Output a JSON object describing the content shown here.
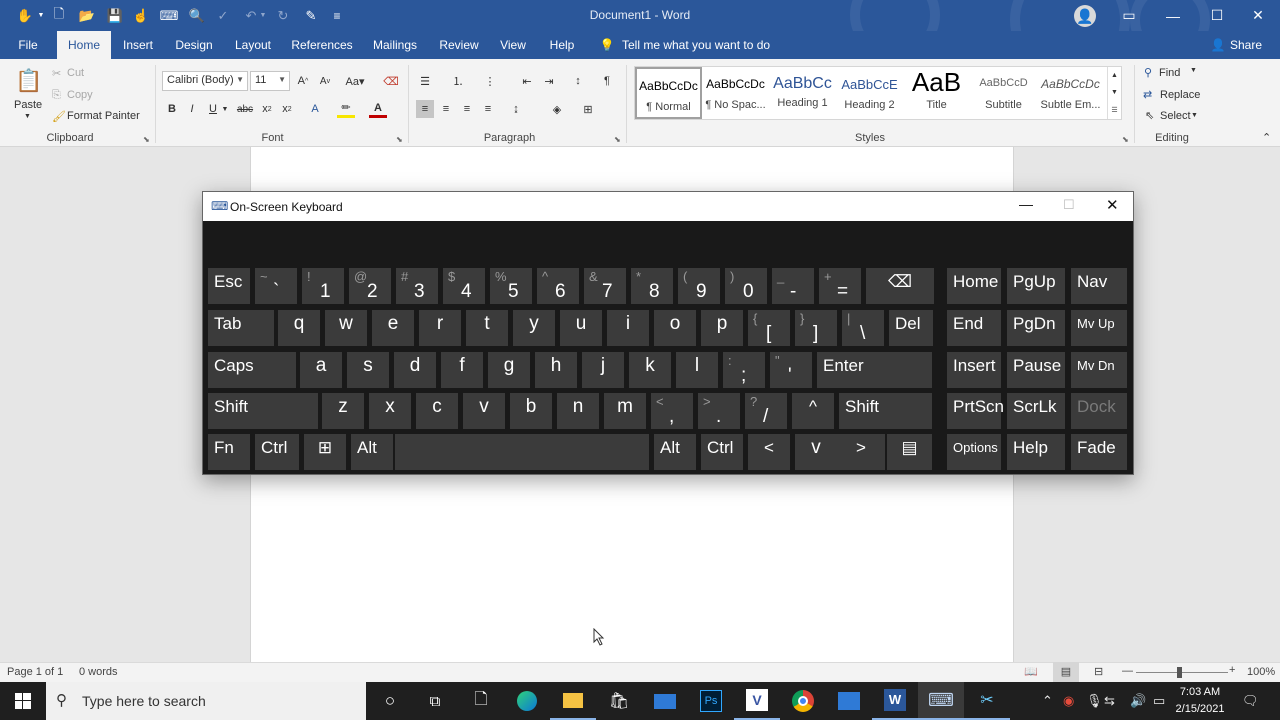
{
  "app": {
    "title": "Document1  -  Word"
  },
  "qat": [
    "autosave-icon",
    "new-document-icon",
    "open-icon",
    "save-icon",
    "touch-mode-icon",
    "undo-icon",
    "redo-icon",
    "repeat-icon",
    "print-preview-icon",
    "customize-icon"
  ],
  "tabs": [
    "File",
    "Home",
    "Insert",
    "Design",
    "Layout",
    "References",
    "Mailings",
    "Review",
    "View",
    "Help"
  ],
  "tell_me": "Tell me what you want to do",
  "share": "Share",
  "ribbon": {
    "clipboard": {
      "label": "Clipboard",
      "paste": "Paste",
      "cut": "Cut",
      "copy": "Copy",
      "format_painter": "Format Painter"
    },
    "font": {
      "label": "Font",
      "name": "Calibri (Body)",
      "size": "11"
    },
    "paragraph": {
      "label": "Paragraph"
    },
    "styles": {
      "label": "Styles",
      "items": [
        {
          "preview": "AaBbCcDc",
          "name": "¶ Normal"
        },
        {
          "preview": "AaBbCcDc",
          "name": "¶ No Spac..."
        },
        {
          "preview": "AaBbCc",
          "name": "Heading 1"
        },
        {
          "preview": "AaBbCcE",
          "name": "Heading 2"
        },
        {
          "preview": "AaB",
          "name": "Title"
        },
        {
          "preview": "AaBbCcD",
          "name": "Subtitle"
        },
        {
          "preview": "AaBbCcDc",
          "name": "Subtle Em..."
        }
      ]
    },
    "editing": {
      "label": "Editing",
      "find": "Find",
      "replace": "Replace",
      "select": "Select"
    }
  },
  "osk": {
    "title": "On-Screen Keyboard",
    "rows": [
      [
        {
          "m": "Esc"
        },
        {
          "s": "~",
          "b": "`"
        },
        {
          "s": "!",
          "b": "1"
        },
        {
          "s": "@",
          "b": "2"
        },
        {
          "s": "#",
          "b": "3"
        },
        {
          "s": "$",
          "b": "4"
        },
        {
          "s": "%",
          "b": "5"
        },
        {
          "s": "^",
          "b": "6"
        },
        {
          "s": "&",
          "b": "7"
        },
        {
          "s": "*",
          "b": "8"
        },
        {
          "s": "(",
          "b": "9"
        },
        {
          "s": ")",
          "b": "0"
        },
        {
          "s": "_",
          "b": "-"
        },
        {
          "s": "+",
          "b": "="
        },
        {
          "m": "⌫"
        },
        {
          "m": "Home"
        },
        {
          "m": "PgUp"
        },
        {
          "m": "Nav"
        }
      ],
      [
        {
          "m": "Tab"
        },
        {
          "m": "q"
        },
        {
          "m": "w"
        },
        {
          "m": "e"
        },
        {
          "m": "r"
        },
        {
          "m": "t"
        },
        {
          "m": "y"
        },
        {
          "m": "u"
        },
        {
          "m": "i"
        },
        {
          "m": "o"
        },
        {
          "m": "p"
        },
        {
          "s": "{",
          "b": "["
        },
        {
          "s": "}",
          "b": "]"
        },
        {
          "s": "|",
          "b": "\\"
        },
        {
          "m": "Del"
        },
        {
          "m": "End"
        },
        {
          "m": "PgDn"
        },
        {
          "m": "Mv Up"
        }
      ],
      [
        {
          "m": "Caps"
        },
        {
          "m": "a"
        },
        {
          "m": "s"
        },
        {
          "m": "d"
        },
        {
          "m": "f"
        },
        {
          "m": "g"
        },
        {
          "m": "h"
        },
        {
          "m": "j"
        },
        {
          "m": "k"
        },
        {
          "m": "l"
        },
        {
          "s": ":",
          "b": ";"
        },
        {
          "s": "\"",
          "b": "'"
        },
        {
          "m": "Enter"
        },
        {
          "m": "Insert"
        },
        {
          "m": "Pause"
        },
        {
          "m": "Mv Dn"
        }
      ],
      [
        {
          "m": "Shift"
        },
        {
          "m": "z"
        },
        {
          "m": "x"
        },
        {
          "m": "c"
        },
        {
          "m": "v"
        },
        {
          "m": "b"
        },
        {
          "m": "n"
        },
        {
          "m": "m"
        },
        {
          "s": "<",
          "b": ","
        },
        {
          "s": ">",
          "b": "."
        },
        {
          "s": "?",
          "b": "/"
        },
        {
          "m": "^"
        },
        {
          "m": "Shift"
        },
        {
          "m": "PrtScn"
        },
        {
          "m": "ScrLk"
        },
        {
          "m": "Dock"
        }
      ],
      [
        {
          "m": "Fn"
        },
        {
          "m": "Ctrl"
        },
        {
          "m": "⊞"
        },
        {
          "m": "Alt"
        },
        {
          "m": ""
        },
        {
          "m": "Alt"
        },
        {
          "m": "Ctrl"
        },
        {
          "m": "<"
        },
        {
          "m": "v"
        },
        {
          "m": ">"
        },
        {
          "m": "▤"
        },
        {
          "m": "Options"
        },
        {
          "m": "Help"
        },
        {
          "m": "Fade"
        }
      ]
    ]
  },
  "status": {
    "page": "Page 1 of 1",
    "words": "0 words",
    "zoom": "100%"
  },
  "taskbar": {
    "search_placeholder": "Type here to search",
    "time": "7:03 AM",
    "date": "2/15/2021"
  }
}
